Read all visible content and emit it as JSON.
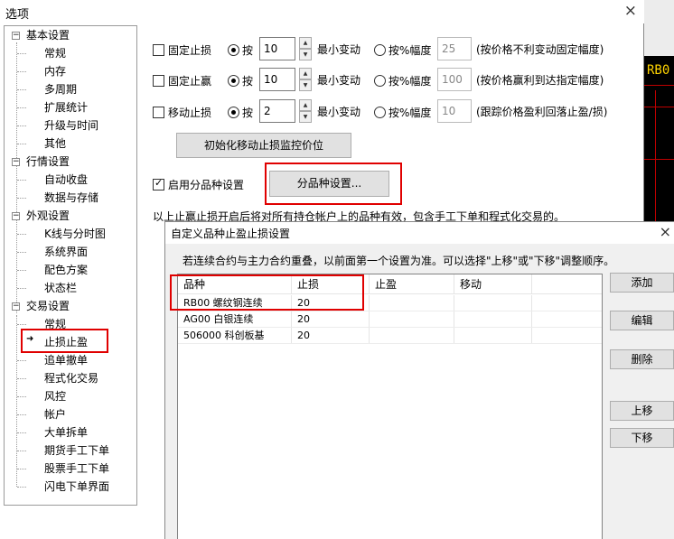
{
  "window": {
    "title": "选项",
    "close_glyph": "×"
  },
  "background_app": {
    "label": "RB0"
  },
  "tree": {
    "groups": [
      {
        "label": "基本设置",
        "toggle": "−",
        "items": [
          "常规",
          "内存",
          "多周期",
          "扩展统计",
          "升级与时间",
          "其他"
        ]
      },
      {
        "label": "行情设置",
        "toggle": "−",
        "items": [
          "自动收盘",
          "数据与存储"
        ]
      },
      {
        "label": "外观设置",
        "toggle": "−",
        "items": [
          "K线与分时图",
          "系统界面",
          "配色方案",
          "状态栏"
        ]
      },
      {
        "label": "交易设置",
        "toggle": "−",
        "items": [
          "常规",
          "止损止盈",
          "追单撤单",
          "程式化交易",
          "风控",
          "帐户",
          "大单拆单",
          "期货手工下单",
          "股票手工下单",
          "闪电下单界面"
        ]
      }
    ],
    "selected": "止损止盈",
    "selected_arrow": "➜"
  },
  "stop_settings": {
    "rows": [
      {
        "checkbox_label": "固定止损",
        "radio_by": "按",
        "value": "10",
        "min_change": "最小变动",
        "radio_pct": "按%幅度",
        "pct_value": "25",
        "note": "(按价格不利变动固定幅度)"
      },
      {
        "checkbox_label": "固定止赢",
        "radio_by": "按",
        "value": "10",
        "min_change": "最小变动",
        "radio_pct": "按%幅度",
        "pct_value": "100",
        "note": "(按价格赢利到达指定幅度)"
      },
      {
        "checkbox_label": "移动止损",
        "radio_by": "按",
        "value": "2",
        "min_change": "最小变动",
        "radio_pct": "按%幅度",
        "pct_value": "10",
        "note": "(跟踪价格盈利回落止盈/损)"
      }
    ],
    "init_button": "初始化移动止损监控价位",
    "enable_label": "启用分品种设置",
    "per_symbol_button": "分品种设置...",
    "footer_text": "以上止赢止损开启后将对所有持仓帐户上的品种有效，包含手工下单和程式化交易的。"
  },
  "sub_dialog": {
    "title": "自定义品种止盈止损设置",
    "close_glyph": "×",
    "hint": "若连续合约与主力合约重叠，以前面第一个设置为准。可以选择\"上移\"或\"下移\"调整顺序。",
    "columns": [
      "品种",
      "止损",
      "止盈",
      "移动"
    ],
    "rows": [
      {
        "symbol": "RB00 螺纹钢连续",
        "stop_loss": "20",
        "take_profit": "",
        "trailing": ""
      },
      {
        "symbol": "AG00 白银连续",
        "stop_loss": "20",
        "take_profit": "",
        "trailing": ""
      },
      {
        "symbol": "506000 科创板基",
        "stop_loss": "20",
        "take_profit": "",
        "trailing": ""
      }
    ],
    "buttons": {
      "add": "添加",
      "edit": "编辑",
      "delete": "删除",
      "move_up": "上移",
      "move_down": "下移"
    }
  }
}
